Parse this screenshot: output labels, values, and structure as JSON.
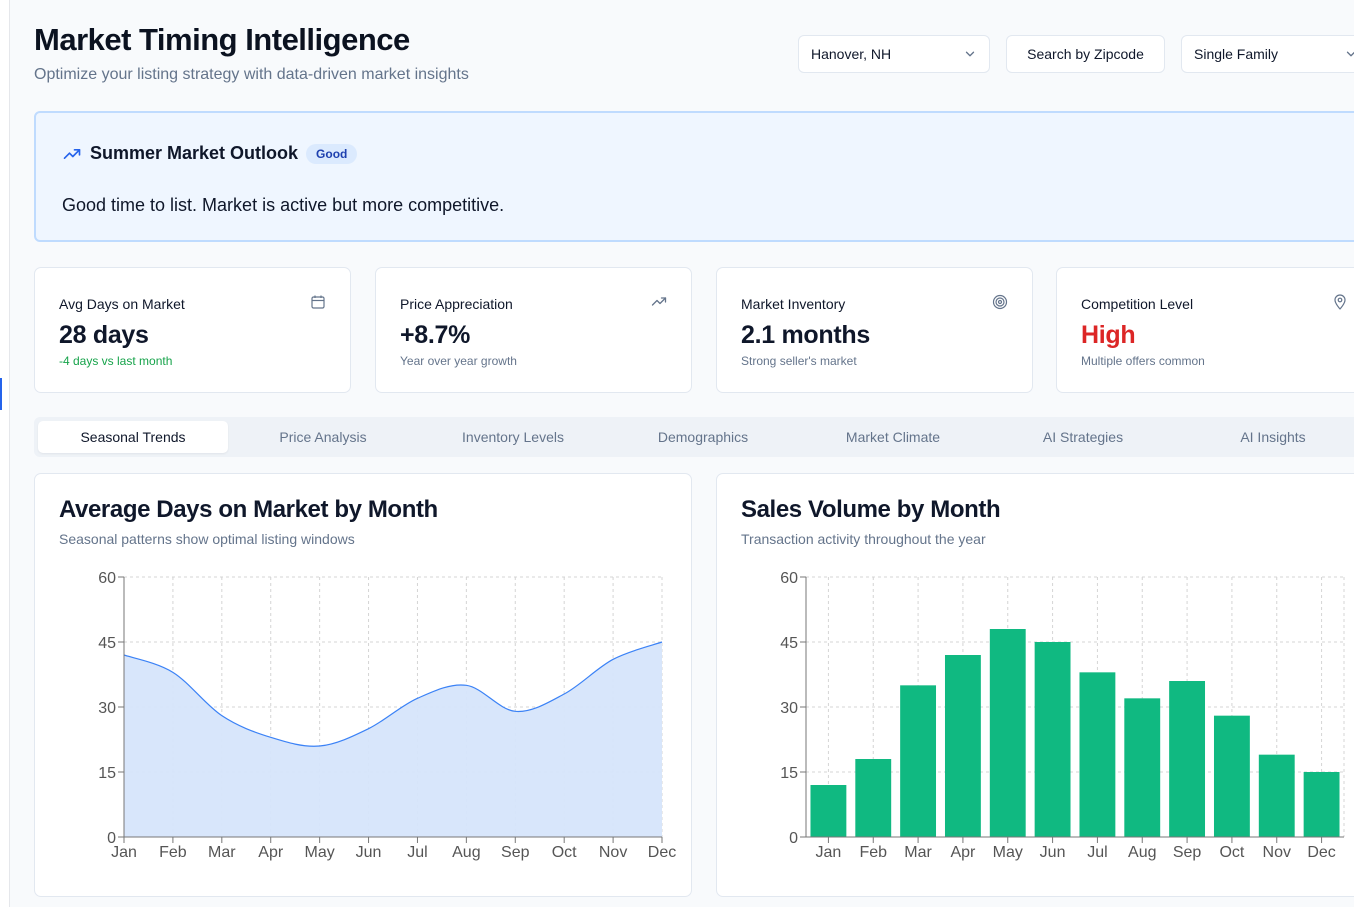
{
  "header": {
    "title": "Market Timing Intelligence",
    "subtitle": "Optimize your listing strategy with data-driven market insights"
  },
  "controls": {
    "location": "Hanover, NH",
    "zip_button": "Search by Zipcode",
    "property_type": "Single Family"
  },
  "outlook": {
    "title": "Summer Market Outlook",
    "badge": "Good",
    "message": "Good time to list. Market is active but more competitive."
  },
  "cards": [
    {
      "label": "Avg Days on Market",
      "value": "28 days",
      "sub": "-4 days vs last month",
      "icon": "calendar-icon"
    },
    {
      "label": "Price Appreciation",
      "value": "+8.7%",
      "sub": "Year over year growth",
      "icon": "trending-up-icon"
    },
    {
      "label": "Market Inventory",
      "value": "2.1 months",
      "sub": "Strong seller's market",
      "icon": "target-icon"
    },
    {
      "label": "Competition Level",
      "value": "High",
      "sub": "Multiple offers common",
      "icon": "map-pin-icon"
    }
  ],
  "colors": {
    "accent": "#2563eb",
    "positive": "#16a34a",
    "danger": "#dc2626",
    "area_fill": "#d6e5fb",
    "area_line": "#3b82f6",
    "bar": "#10b981"
  },
  "tabs": [
    "Seasonal Trends",
    "Price Analysis",
    "Inventory Levels",
    "Demographics",
    "Market Climate",
    "AI Strategies",
    "AI Insights"
  ],
  "active_tab": "Seasonal Trends",
  "panels": {
    "days": {
      "title": "Average Days on Market by Month",
      "subtitle": "Seasonal patterns show optimal listing windows"
    },
    "sales": {
      "title": "Sales Volume by Month",
      "subtitle": "Transaction activity throughout the year"
    }
  },
  "chart_data": [
    {
      "type": "area",
      "title": "Average Days on Market by Month",
      "categories": [
        "Jan",
        "Feb",
        "Mar",
        "Apr",
        "May",
        "Jun",
        "Jul",
        "Aug",
        "Sep",
        "Oct",
        "Nov",
        "Dec"
      ],
      "values": [
        42,
        38,
        28,
        23,
        21,
        25,
        32,
        35,
        29,
        33,
        41,
        45
      ],
      "ylim": [
        0,
        60
      ],
      "yticks": [
        0,
        15,
        30,
        45,
        60
      ],
      "grid": true
    },
    {
      "type": "bar",
      "title": "Sales Volume by Month",
      "categories": [
        "Jan",
        "Feb",
        "Mar",
        "Apr",
        "May",
        "Jun",
        "Jul",
        "Aug",
        "Sep",
        "Oct",
        "Nov",
        "Dec"
      ],
      "values": [
        12,
        18,
        35,
        42,
        48,
        45,
        38,
        32,
        36,
        28,
        19,
        15
      ],
      "ylim": [
        0,
        60
      ],
      "yticks": [
        0,
        15,
        30,
        45,
        60
      ],
      "grid": true
    }
  ]
}
